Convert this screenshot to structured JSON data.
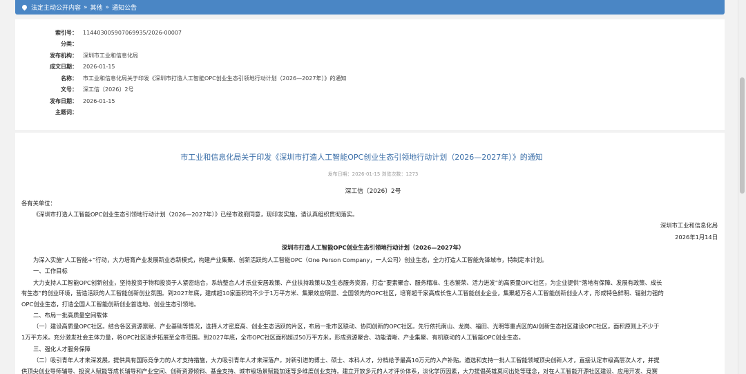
{
  "breadcrumb": {
    "items": [
      "法定主动公开内容",
      "其他",
      "通知公告"
    ],
    "separator": "»"
  },
  "meta": {
    "rows": [
      {
        "label": "索引号：",
        "value": "114403005907069935/2026-00007"
      },
      {
        "label": "分类：",
        "value": ""
      },
      {
        "label": "发布机构：",
        "value": "深圳市工业和信息化局"
      },
      {
        "label": "成文日期：",
        "value": "2026-01-15"
      },
      {
        "label": "名称：",
        "value": "市工业和信息化局关于印发《深圳市打造人工智能OPC创业生态引领地行动计划（2026—2027年）》的通知"
      },
      {
        "label": "文号：",
        "value": "深工信〔2026〕2号"
      },
      {
        "label": "发布日期：",
        "value": "2026-01-15"
      },
      {
        "label": "主题词：",
        "value": ""
      }
    ]
  },
  "document": {
    "title": "市工业和信息化局关于印发《深圳市打造人工智能OPC创业生态引领地行动计划（2026—2027年）》的通知",
    "info": "发布日期：2026-01-15  浏览次数：1273",
    "doc_number": "深工信〔2026〕2号",
    "salutation": "各有关单位：",
    "intro": "《深圳市打造人工智能OPC创业生态引领地行动计划（2026—2027年）》已经市政府同意，现印发实施，请认真组织贯彻落实。",
    "issuer": "深圳市工业和信息化局",
    "date": "2026年1月14日",
    "plan_title": "深圳市打造人工智能OPC创业生态引领地行动计划（2026—2027年）",
    "p_intro": "为深入实施“人工智能+”行动，大力培育产业发展新业态新模式，构建产业集聚、创新活跃的人工智能OPC（One Person Company，一人公司）创业生态，全力打造人工智能先锋城市，特制定本计划。",
    "h1": "一、工作目标",
    "p1a": "大力支持人工智能OPC创新创业，坚持投资于物和投资于人紧密结合，系统整合人才乐业安居政策、产业扶持政策以及生态服务资源，打造“要素聚合、服务精准、生态繁荣、活力迸发”的高质量OPC社区，为企业提供“落地有保障、发展有政策、成长",
    "p1b": "有生态”的创业环境，营造活跃的人工智能创新创业氛围。到2027年底，建成超10家面积均不少于1万平方米、集聚效应明显、全国领先的OPC社区，培育超千家高成长性人工智能创业企业，集聚超万名人工智能创新创业人才，形成特色鲜明、辐射力强的",
    "p1c": "OPC创业生态，打造全国人工智能创新创业首选地、创业生态引领地。",
    "h2": "二、布局一批高质量空间载体",
    "p2a": "（一）建设高质量OPC社区。结合各区资源禀赋、产业基础等情况，选择人才密度高、创业生态活跃的片区，布局一批市区联动、协同创新的OPC社区。先行依托南山、龙岗、福田、光明等重点区的AI创新生态社区建设OPC社区，面积原则上不少于",
    "p2b": "1万平方米。充分激发社会主体力量，将OPC社区逐步拓展至全市范围。到2027年底，全市OPC社区面积超过50万平方米，形成资源聚合、功能清晰、产业集聚、有机联动的人工智能OPC创业生态。",
    "h3": "三、强化人才服务保障",
    "p3a": "（二）吸引青年人才来深发展。提供具有国际竞争力的人才支持措施，大力吸引青年人才来深落户。对新引进的博士、硕士、本科人才，分档给予最高10万元的入户补贴。遴选和支持一批人工智能领域顶尖创新人才，直接认定市级高层次人才，并提",
    "p3b": "供顶尖创业导师辅导、投资人赋能等成长辅导和产业空间、创新资源倾斜、基金支持、城市级场景赋能加速等多维度创业支持。建立开放多元的人才评价体系，淡化学历因素，大力提倡英雄莫问出处等理念，对在人工智能开源社区建设、应用开发、竞赛"
  }
}
